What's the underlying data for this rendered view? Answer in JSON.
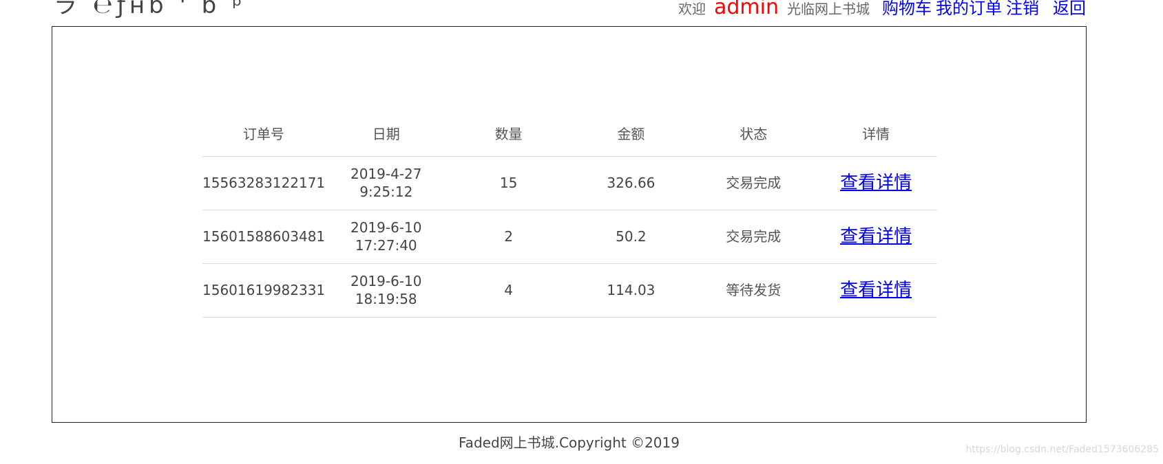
{
  "header": {
    "logo_text": "ラ ℮ƒнɓ ' ɓ ᵖ",
    "welcome": "欢迎",
    "username": "admin",
    "visit_text": "光临网上书城",
    "nav": {
      "cart": "购物车",
      "my_orders": "我的订单",
      "logout": "注销",
      "back": "返回"
    }
  },
  "orders_table": {
    "headers": [
      "订单号",
      "日期",
      "数量",
      "金额",
      "状态",
      "详情"
    ],
    "rows": [
      {
        "order_id": "15563283122171",
        "date": "2019-4-27",
        "time": "9:25:12",
        "quantity": "15",
        "amount": "326.66",
        "status": "交易完成",
        "detail": "查看详情"
      },
      {
        "order_id": "15601588603481",
        "date": "2019-6-10",
        "time": "17:27:40",
        "quantity": "2",
        "amount": "50.2",
        "status": "交易完成",
        "detail": "查看详情"
      },
      {
        "order_id": "15601619982331",
        "date": "2019-6-10",
        "time": "18:19:58",
        "quantity": "4",
        "amount": "114.03",
        "status": "等待发货",
        "detail": "查看详情"
      }
    ]
  },
  "footer": {
    "copyright": "Faded网上书城.Copyright ©2019"
  },
  "watermark": "https://blog.csdn.net/Faded1573606285",
  "colors": {
    "username": "#ff0000",
    "nav_link": "#0000ff",
    "detail_link": "#0000ee",
    "border": "#222222",
    "row_divider": "#dddddd"
  }
}
